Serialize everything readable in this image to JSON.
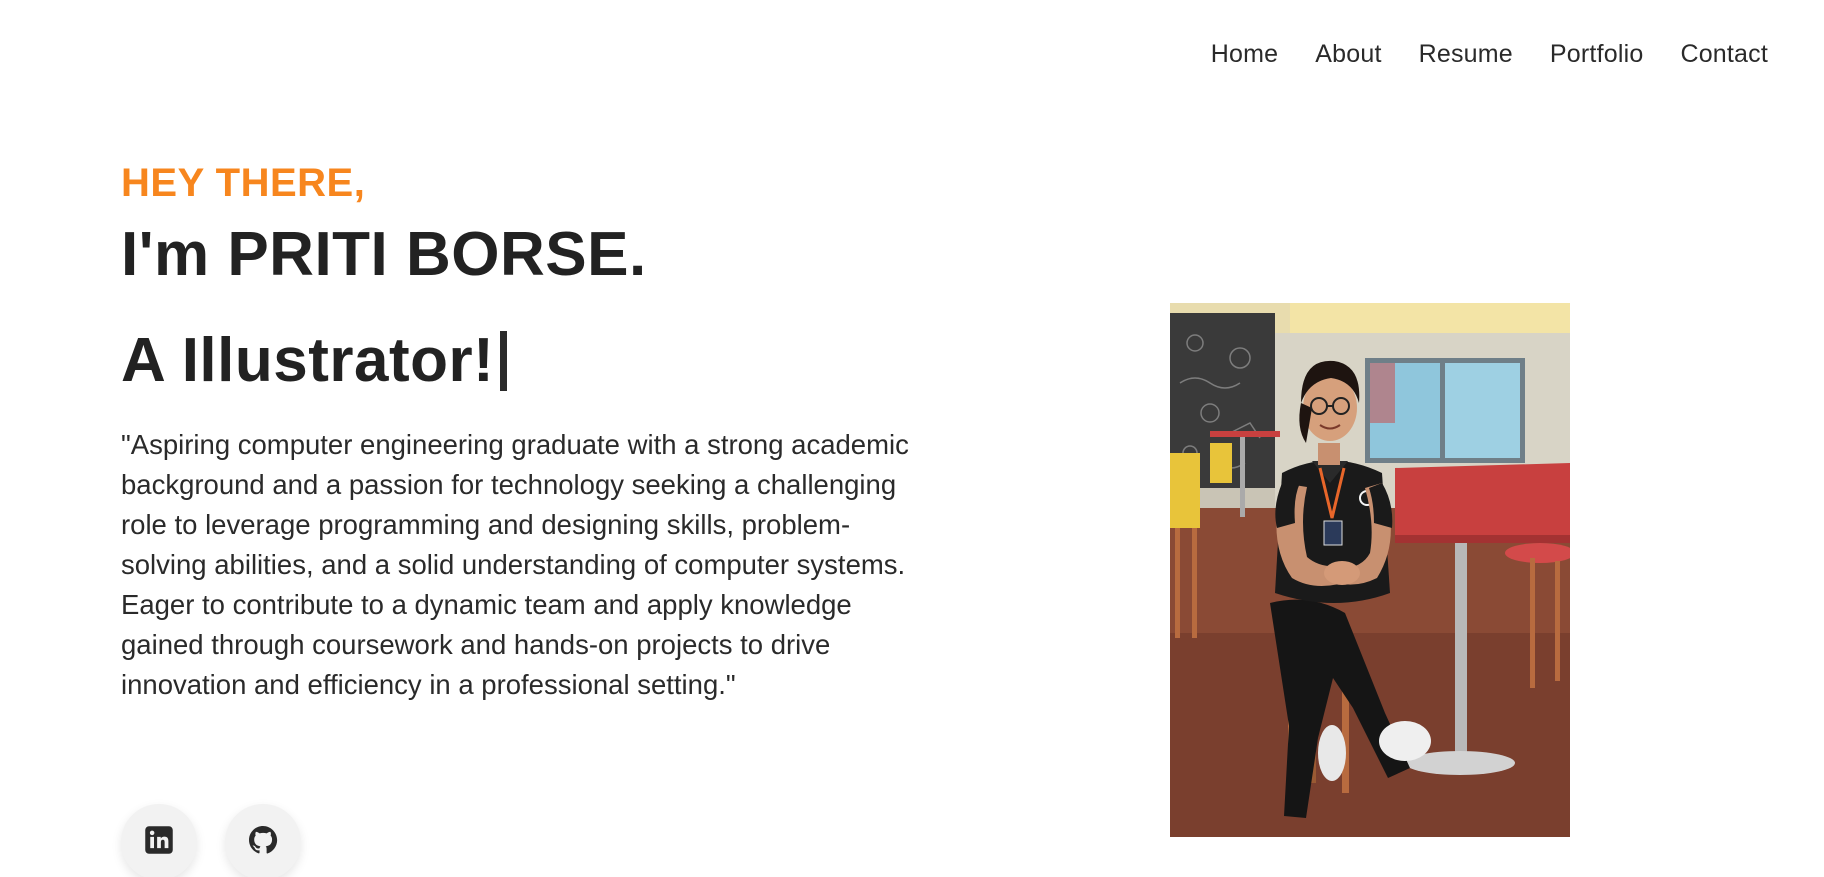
{
  "nav": {
    "items": [
      {
        "label": "Home"
      },
      {
        "label": "About"
      },
      {
        "label": "Resume"
      },
      {
        "label": "Portfolio"
      },
      {
        "label": "Contact"
      }
    ]
  },
  "hero": {
    "greeting": "HEY THERE,",
    "name": "I'm PRITI BORSE.",
    "role": "A Illustrator!",
    "bio": "\"Aspiring computer engineering graduate with a strong academic background and a passion for technology seeking a challenging role to leverage programming and designing skills, problem-solving abilities, and a solid understanding of computer systems. Eager to contribute to a dynamic team and apply knowledge gained through coursework and hands-on projects to drive innovation and efficiency in a professional setting.\""
  },
  "socials": [
    {
      "icon": "linkedin-icon"
    },
    {
      "icon": "github-icon"
    }
  ],
  "colors": {
    "accent": "#f7861e",
    "text": "#222222",
    "background": "#ffffff"
  }
}
